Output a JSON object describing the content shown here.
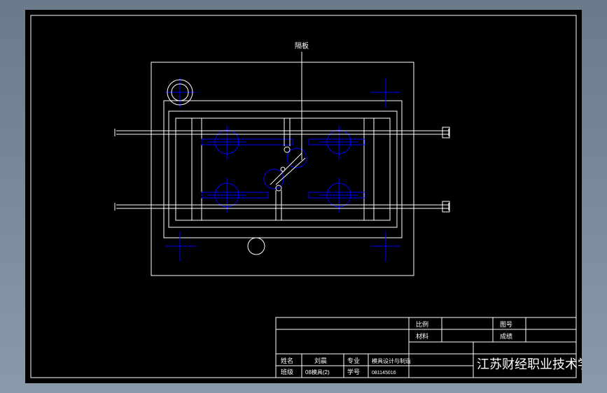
{
  "annotation": {
    "label": "隔板"
  },
  "titleblock": {
    "labels": {
      "ratio": "比例",
      "drawing_no": "图号",
      "material": "材料",
      "grade": "成绩",
      "name": "姓名",
      "major": "专业",
      "class": "班级",
      "student_id": "学号"
    },
    "values": {
      "name": "刘晨",
      "major": "模具设计与制造",
      "class": "08模具(2)",
      "student_id": "081145016"
    },
    "school": "江苏财经职业技术学院"
  }
}
